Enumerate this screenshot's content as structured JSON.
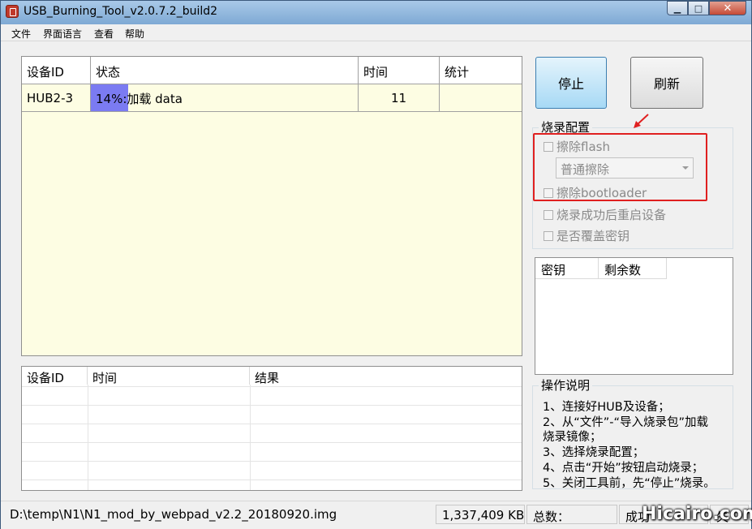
{
  "window": {
    "title": "USB_Burning_Tool_v2.0.7.2_build2"
  },
  "menu": {
    "items": [
      "文件",
      "界面语言",
      "查看",
      "帮助"
    ]
  },
  "device_table": {
    "headers": [
      "设备ID",
      "状态",
      "时间",
      "统计"
    ],
    "rows": [
      {
        "device_id": "HUB2-3",
        "status": "14%:加载 data",
        "progress_percent": 14,
        "time": "11",
        "stats": ""
      }
    ]
  },
  "buttons": {
    "stop": "停止",
    "refresh": "刷新"
  },
  "burn_config": {
    "label": "烧录配置",
    "erase_flash": "擦除flash",
    "erase_mode": "普通擦除",
    "erase_bootloader": "擦除bootloader",
    "reboot_after": "烧录成功后重启设备",
    "overwrite_key": "是否覆盖密钥"
  },
  "key_table": {
    "headers": [
      "密钥",
      "剩余数"
    ]
  },
  "log_table": {
    "headers": [
      "设备ID",
      "时间",
      "结果"
    ]
  },
  "instructions": {
    "label": "操作说明",
    "lines": [
      "1、连接好HUB及设备；",
      "2、从“文件”-“导入烧录包”加载",
      "烧录镜像；",
      "3、选择烧录配置；",
      "4、点击“开始”按钮启动烧录；",
      "5、关闭工具前，先“停止”烧录。"
    ]
  },
  "status_bar": {
    "path": "D:\\temp\\N1\\N1_mod_by_webpad_v2.2_20180920.img",
    "size": "1,337,409 KB",
    "total_label": "总数：",
    "success_label": "成功",
    "fail_label": "失"
  },
  "watermark": "Hicairo.com",
  "colors": {
    "progress": "#7b7bf2",
    "table_bg": "#fdfde3",
    "highlight": "#e02020"
  }
}
